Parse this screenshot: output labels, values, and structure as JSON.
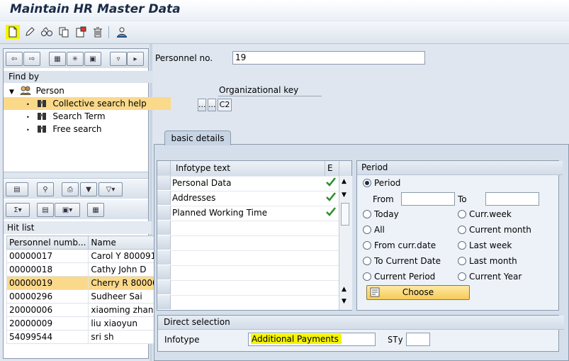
{
  "window": {
    "title": "Maintain HR Master Data"
  },
  "toolbar": {
    "icons": [
      "create-icon",
      "change-icon",
      "display-icon",
      "copy-icon",
      "delimit-icon",
      "delete-icon",
      "overview-icon"
    ]
  },
  "nav": {
    "find_by": "Find by",
    "tree_root": "Person",
    "tree_items": [
      "Collective search help",
      "Search Term",
      "Free search"
    ],
    "hit_list_label": "Hit list",
    "columns": [
      "Personnel numb...",
      "Name"
    ],
    "rows": [
      [
        "00000017",
        "Carol Y 800091"
      ],
      [
        "00000018",
        "Cathy John D"
      ],
      [
        "00000019",
        "Cherry R 80000"
      ],
      [
        "00000296",
        "Sudheer Sai"
      ],
      [
        "20000006",
        "xiaoming zhang"
      ],
      [
        "20000009",
        "liu xiaoyun"
      ],
      [
        "54099544",
        "sri sh"
      ]
    ]
  },
  "header": {
    "personnel_label": "Personnel no.",
    "personnel_value": "19",
    "org_key_label": "Organizational key",
    "org_key_btn1": "...",
    "org_key_btn2": "...",
    "org_key_value": "C2"
  },
  "tabs": {
    "basic_details": "basic details"
  },
  "infotypes": {
    "col_text": "Infotype text",
    "col_e": "E",
    "rows": [
      "Personal Data",
      "Addresses",
      "Planned Working Time"
    ]
  },
  "period": {
    "title": "Period",
    "period_radio": "Period",
    "from_label": "From",
    "to_label": "To",
    "from_value": "",
    "to_value": "",
    "today": "Today",
    "curr_week": "Curr.week",
    "all": "All",
    "current_month": "Current month",
    "from_curr_date": "From curr.date",
    "last_week": "Last week",
    "to_current_date": "To Current Date",
    "last_month": "Last month",
    "current_period": "Current Period",
    "current_year": "Current Year",
    "choose": "Choose"
  },
  "direct_selection": {
    "title": "Direct selection",
    "infotype_label": "Infotype",
    "infotype_value": "Additional Payments",
    "sty_label": "STy",
    "sty_value": ""
  },
  "colors": {
    "highlight": "#fbd98b",
    "yellow": "#f4f400",
    "background": "#dfe6ef"
  }
}
